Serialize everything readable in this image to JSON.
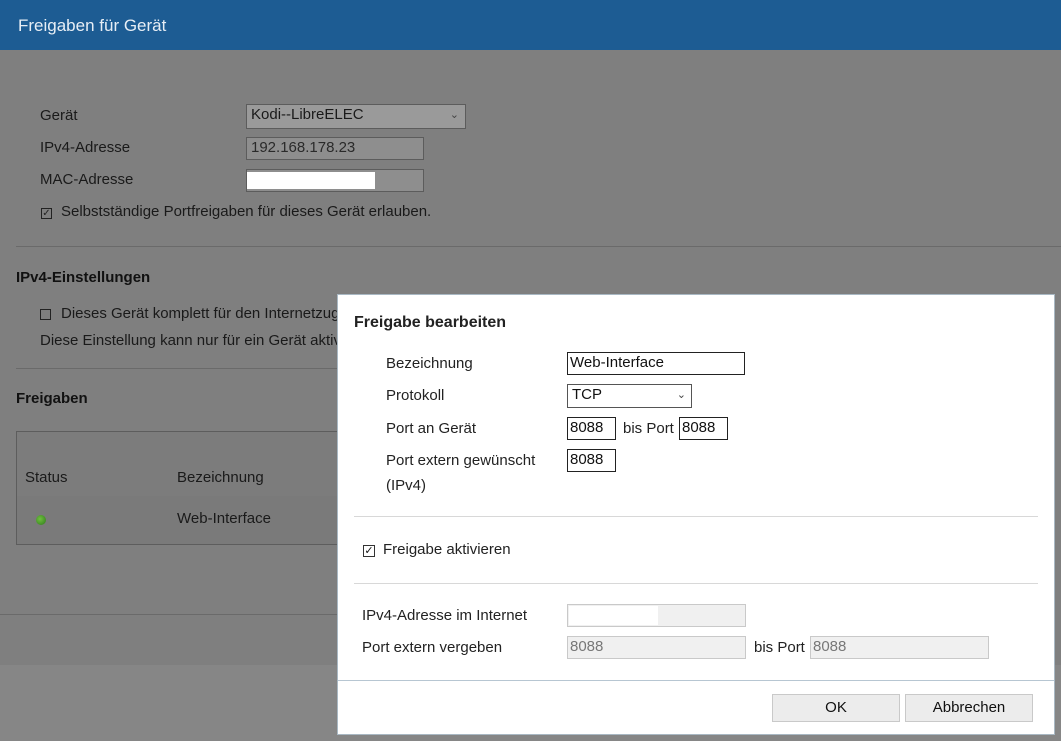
{
  "window": {
    "title": "Freigaben für Gerät"
  },
  "device": {
    "geraet_label": "Gerät",
    "geraet_value": "Kodi--LibreELEC",
    "ipv4_label": "IPv4-Adresse",
    "ipv4_value": "192.168.178.23",
    "mac_label": "MAC-Adresse",
    "mac_value": "",
    "allow_label": "Selbstständige Portfreigaben für dieses Gerät erlauben.",
    "allow_checked": true
  },
  "ipv4_settings": {
    "heading": "IPv4-Einstellungen",
    "expose_label": "Dieses Gerät komplett für den Internetzug",
    "note": "Diese Einstellung kann nur für ein Gerät aktiv"
  },
  "shares": {
    "heading": "Freigaben",
    "columns": [
      "Status",
      "Bezeichnung"
    ],
    "rows": [
      {
        "status": "active",
        "name": "Web-Interface"
      }
    ]
  },
  "dialog": {
    "title": "Freigabe bearbeiten",
    "bezeichnung_label": "Bezeichnung",
    "bezeichnung_value": "Web-Interface",
    "protokoll_label": "Protokoll",
    "protokoll_value": "TCP",
    "port_geraet_label": "Port an Gerät",
    "port_geraet_value": "8088",
    "bis_port_label": "bis Port",
    "port_geraet_bis_value": "8088",
    "port_extern_label_1": "Port extern gewünscht",
    "port_extern_label_2": "(IPv4)",
    "port_extern_value": "8088",
    "aktivieren_label": "Freigabe aktivieren",
    "aktivieren_checked": true,
    "ipv4_internet_label": "IPv4-Adresse im Internet",
    "ipv4_internet_value": "",
    "port_vergeben_label": "Port extern vergeben",
    "port_vergeben_value": "8088",
    "bis_port_label_2": "bis Port",
    "port_vergeben_bis_value": "8088",
    "ok_label": "OK",
    "cancel_label": "Abbrechen"
  }
}
